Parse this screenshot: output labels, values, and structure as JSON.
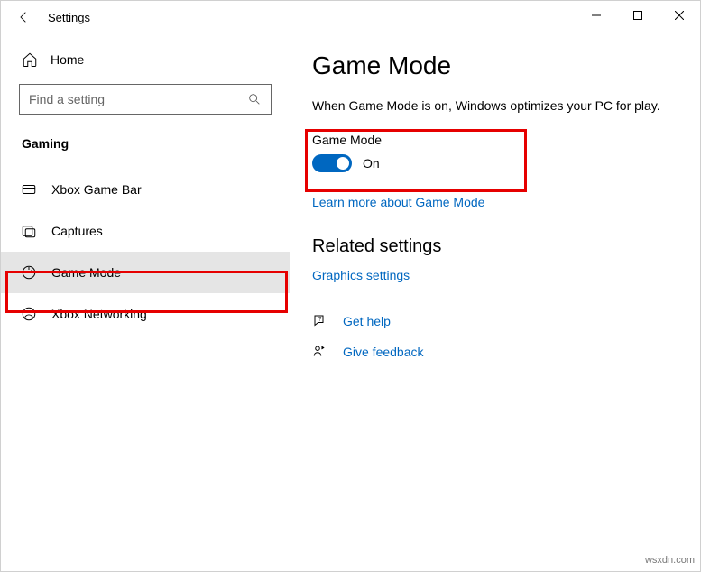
{
  "window": {
    "title": "Settings"
  },
  "sidebar": {
    "home": "Home",
    "search_placeholder": "Find a setting",
    "category": "Gaming",
    "items": [
      {
        "label": "Xbox Game Bar"
      },
      {
        "label": "Captures"
      },
      {
        "label": "Game Mode"
      },
      {
        "label": "Xbox Networking"
      }
    ]
  },
  "main": {
    "title": "Game Mode",
    "desc": "When Game Mode is on, Windows optimizes your PC for play.",
    "toggle_label": "Game Mode",
    "toggle_state": "On",
    "learn_more": "Learn more about Game Mode",
    "related_heading": "Related settings",
    "graphics": "Graphics settings",
    "help": "Get help",
    "feedback": "Give feedback"
  },
  "watermark": "wsxdn.com"
}
